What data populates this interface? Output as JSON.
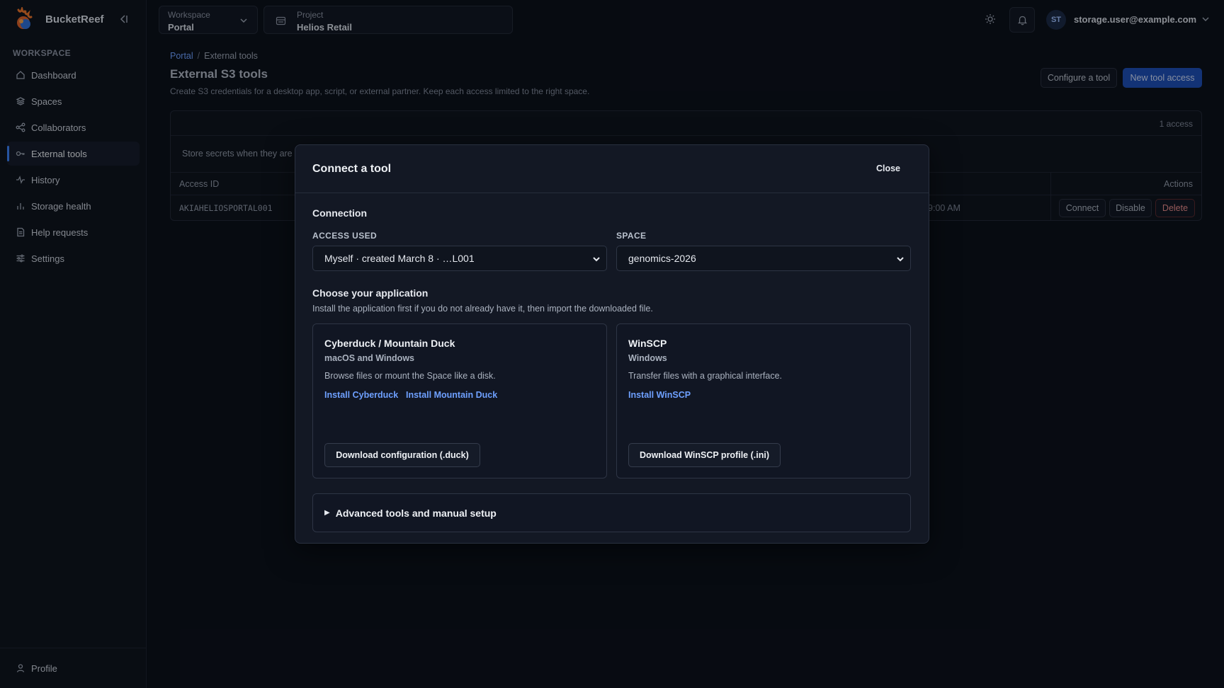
{
  "brand": {
    "name": "BucketReef"
  },
  "sidebar": {
    "section_label": "WORKSPACE",
    "items": [
      {
        "label": "Dashboard",
        "icon": "home-icon"
      },
      {
        "label": "Spaces",
        "icon": "layers-icon"
      },
      {
        "label": "Collaborators",
        "icon": "share-icon"
      },
      {
        "label": "External tools",
        "icon": "key-icon",
        "active": true
      },
      {
        "label": "History",
        "icon": "activity-icon"
      },
      {
        "label": "Storage health",
        "icon": "bar-chart-icon"
      },
      {
        "label": "Help requests",
        "icon": "file-icon"
      },
      {
        "label": "Settings",
        "icon": "sliders-icon"
      }
    ],
    "footer": {
      "label": "Profile",
      "icon": "user-icon"
    }
  },
  "topbar": {
    "workspace": {
      "label": "Workspace",
      "value": "Portal"
    },
    "project": {
      "label": "Project",
      "value": "Helios Retail"
    },
    "user": {
      "initials": "ST",
      "email": "storage.user@example.com"
    }
  },
  "page": {
    "breadcrumb": {
      "root": "Portal",
      "sep": "/",
      "current": "External tools"
    },
    "title": "External S3 tools",
    "subtitle": "Create S3 credentials for a desktop app, script, or external partner. Keep each access limited to the right space.",
    "actions": {
      "configure": "Configure a tool",
      "new_access": "New tool access"
    }
  },
  "table": {
    "count": "1 access",
    "notice": "Store secrets when they are",
    "headers": {
      "id": "Access ID",
      "actions": "Actions"
    },
    "row": {
      "id": "AKIAHELIOSPORTAL001",
      "time": "9:00 AM",
      "connect": "Connect",
      "disable": "Disable",
      "delete": "Delete"
    }
  },
  "modal": {
    "title": "Connect a tool",
    "close": "Close",
    "connection": {
      "heading": "Connection",
      "access_label": "ACCESS USED",
      "access_value": "Myself · created March 8 · …L001",
      "space_label": "SPACE",
      "space_value": "genomics-2026"
    },
    "apps": {
      "heading": "Choose your application",
      "subtitle": "Install the application first if you do not already have it, then import the downloaded file.",
      "cyberduck": {
        "title": "Cyberduck / Mountain Duck",
        "platform": "macOS and Windows",
        "desc": "Browse files or mount the Space like a disk.",
        "link1": "Install Cyberduck",
        "link2": "Install Mountain Duck",
        "download": "Download configuration (.duck)"
      },
      "winscp": {
        "title": "WinSCP",
        "platform": "Windows",
        "desc": "Transfer files with a graphical interface.",
        "link1": "Install WinSCP",
        "download": "Download WinSCP profile (.ini)"
      }
    },
    "advanced": {
      "caret": "▶",
      "label": "Advanced tools and manual setup"
    }
  },
  "colors": {
    "accent": "#3b82f6",
    "primary_button": "#1e4fb6",
    "link": "#6ea0ff",
    "danger": "#e58a8a",
    "background": "#0c111b"
  }
}
